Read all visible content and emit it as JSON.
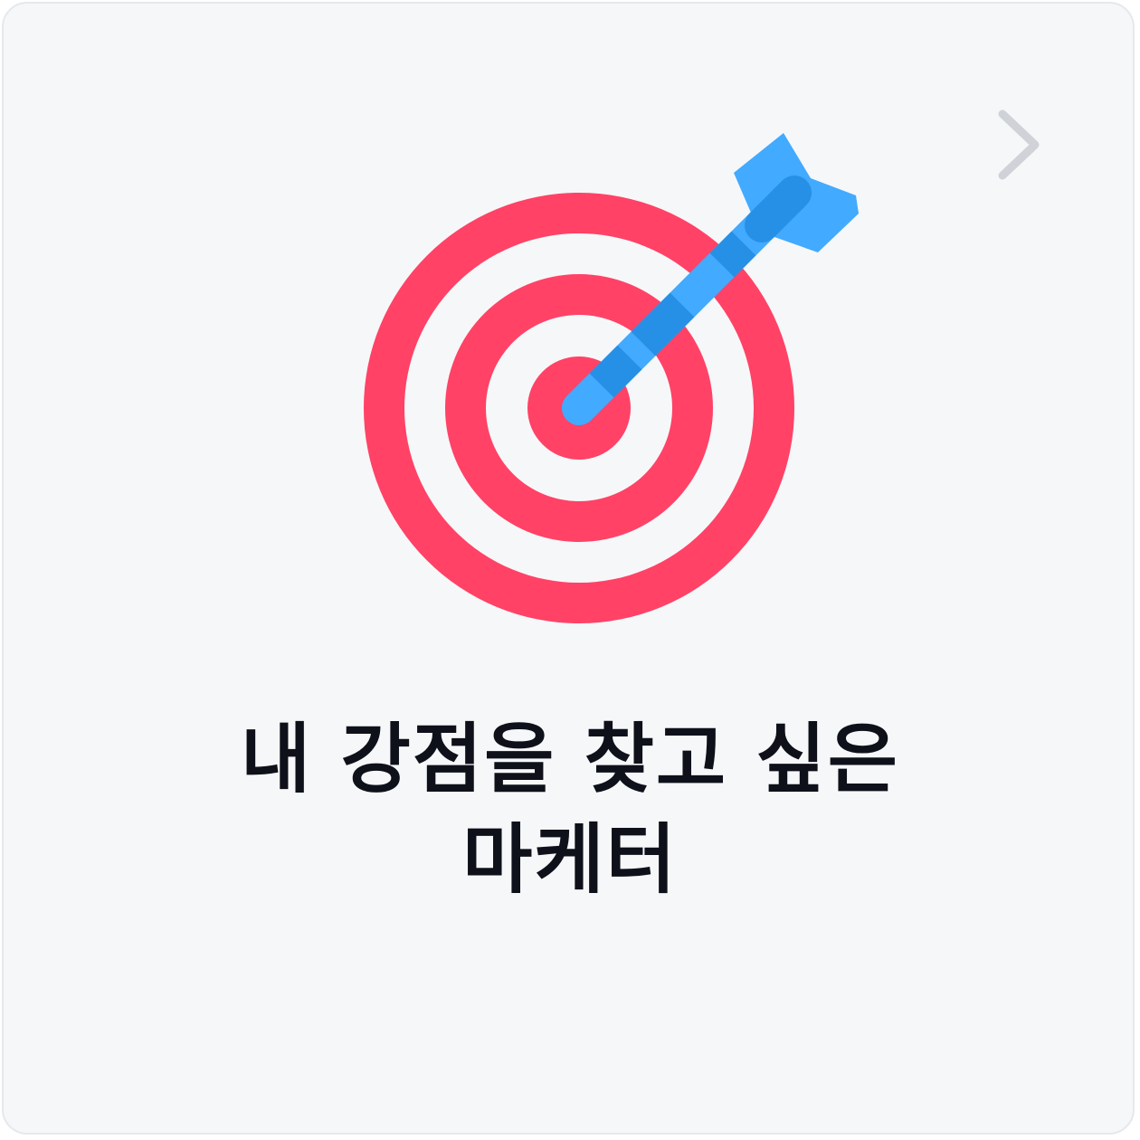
{
  "card": {
    "title_line1": "내 강점을 찾고 싶은",
    "title_line2": "마케터",
    "icon": "target-with-arrow-icon",
    "nav_icon": "chevron-right-icon"
  },
  "colors": {
    "background": "#f6f7f9",
    "target_red": "#ff4266",
    "arrow_blue": "#42aaff",
    "arrow_dark_blue": "#2690e6",
    "chevron_gray": "#cfd2d6",
    "text": "#0e111a"
  }
}
